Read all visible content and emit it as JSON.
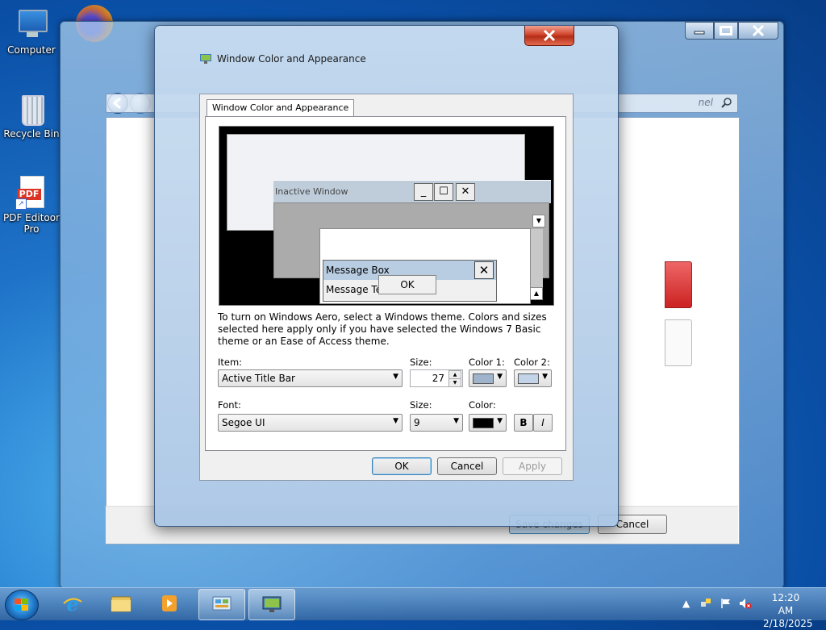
{
  "desktop": {
    "icons": [
      {
        "label": "Computer"
      },
      {
        "label": "Recycle Bin"
      },
      {
        "label": "PDF Editoor Pro"
      }
    ],
    "firefox_label": "Firefox"
  },
  "background_window": {
    "search_placeholder": "nel",
    "save_label": "Save changes",
    "cancel_label": "Cancel"
  },
  "dialog": {
    "title": "Window Color and Appearance",
    "close_glyph": "✕",
    "tab_label": "Window Color and Appearance",
    "preview": {
      "inactive_title": "Inactive Window",
      "message_box_title": "Message Box",
      "message_text": "Message Text",
      "ok_label": "OK"
    },
    "description": "To turn on Windows Aero, select a Windows theme.  Colors and sizes selected here apply only if you have selected the Windows 7 Basic theme or an Ease of Access theme.",
    "item_label": "Item:",
    "item_value": "Active Title Bar",
    "size_label": "Size:",
    "size_value": "27",
    "color1_label": "Color 1:",
    "color2_label": "Color 2:",
    "color1": "#9fb4cc",
    "color2": "#c4d4e8",
    "font_label": "Font:",
    "font_value": "Segoe UI",
    "font_size_label": "Size:",
    "font_size_value": "9",
    "font_color_label": "Color:",
    "font_color": "#000000",
    "bold_label": "B",
    "italic_label": "I",
    "ok_label": "OK",
    "cancel_label": "Cancel",
    "apply_label": "Apply"
  },
  "taskbar": {
    "time": "12:20 AM",
    "date": "2/18/2025"
  }
}
